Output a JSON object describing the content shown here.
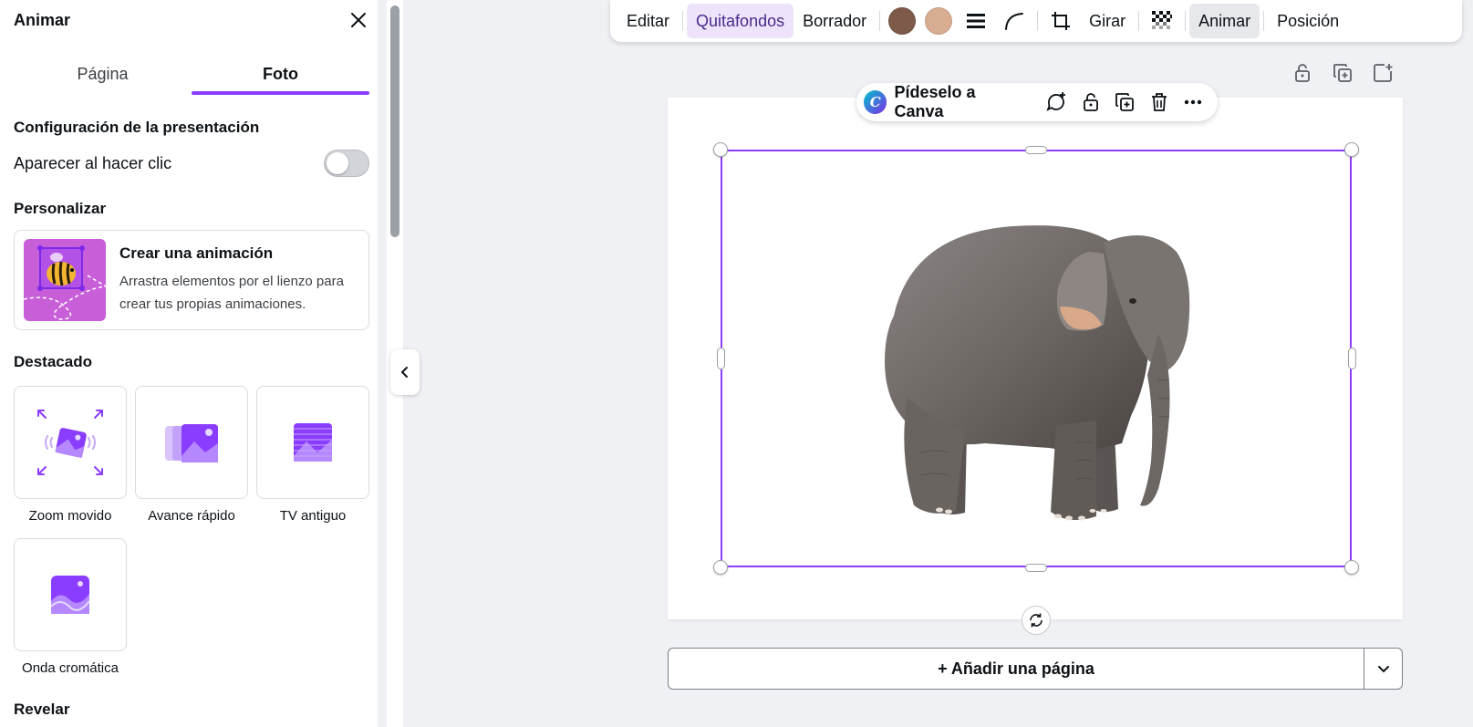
{
  "panel": {
    "title": "Animar",
    "tabs": [
      {
        "label": "Página"
      },
      {
        "label": "Foto"
      }
    ],
    "active_tab": "Foto",
    "presentation_section": "Configuración de la presentación",
    "appear_on_click_label": "Aparecer al hacer clic",
    "appear_on_click_enabled": false,
    "customize_section": "Personalizar",
    "create_card": {
      "title": "Crear una animación",
      "description": "Arrastra elementos por el lienzo para crear tus propias animaciones."
    },
    "featured_section": "Destacado",
    "animations": [
      {
        "label": "Zoom movido"
      },
      {
        "label": "Avance rápido"
      },
      {
        "label": "TV antiguo"
      },
      {
        "label": "Onda cromática"
      }
    ],
    "reveal_section": "Revelar"
  },
  "toolbar": {
    "edit": "Editar",
    "bg_remover": "Quitafondos",
    "eraser": "Borrador",
    "swatch_1": "#7d5a4a",
    "swatch_2": "#d9ad92",
    "rotate": "Girar",
    "animate": "Animar",
    "position": "Posición"
  },
  "ask_pill": {
    "label": "Pídeselo a Canva",
    "logo_letter": "C"
  },
  "add_page": {
    "label": "+ Añadir una página"
  },
  "colors": {
    "accent": "#8b3dff",
    "accent_light": "#ede4fb"
  }
}
